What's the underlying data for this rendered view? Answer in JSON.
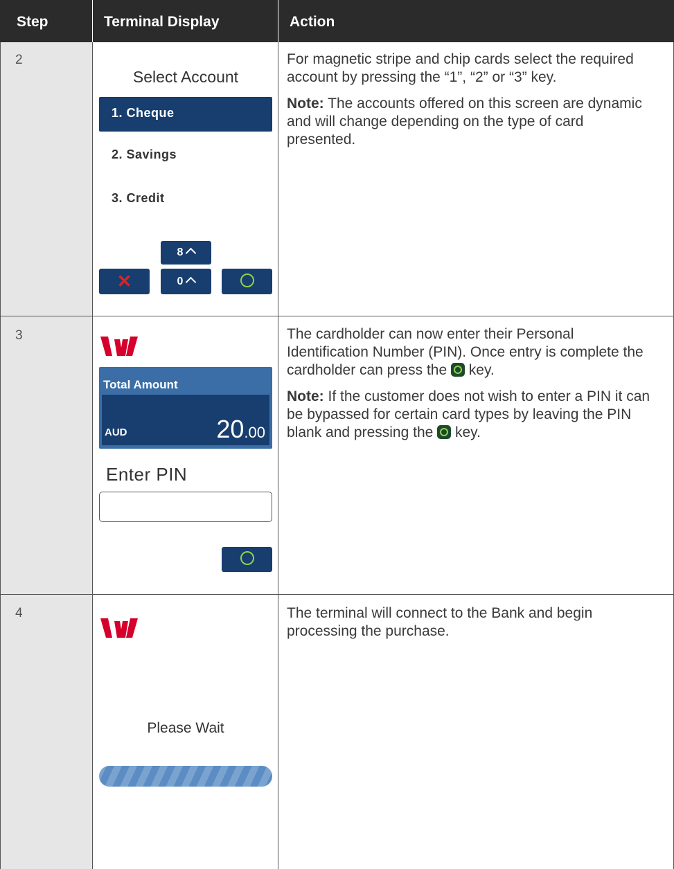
{
  "header": {
    "step": "Step",
    "display": "Terminal Display",
    "action": "Action"
  },
  "rows": [
    {
      "step": "2",
      "screen": {
        "title": "Select Account",
        "options": [
          "1. Cheque",
          "2. Savings",
          "3. Credit"
        ],
        "keys": {
          "up": "8",
          "down": "0"
        }
      },
      "action_p1": "For magnetic stripe and chip cards select the required account by pressing the “1”, “2” or “3” key.",
      "note_label": "Note:",
      "note_text": " The accounts offered on this screen are dynamic and will change depending on the type of card presented."
    },
    {
      "step": "3",
      "screen": {
        "amount_label": "Total Amount",
        "currency": "AUD",
        "amount_whole": "20",
        "amount_cents": ".00",
        "prompt": "Enter PIN"
      },
      "action_p1a": "The cardholder can now enter their Personal Identification Number (PIN). Once entry is complete the cardholder can press the ",
      "action_p1b": " key.",
      "note_label": "Note:",
      "note_text_a": " If the customer does not wish to enter a PIN it can be bypassed for certain card types by leaving the PIN blank and pressing the ",
      "note_text_b": " key."
    },
    {
      "step": "4",
      "screen": {
        "message": "Please Wait"
      },
      "action_p1": "The terminal will connect to the Bank and begin processing the purchase."
    }
  ],
  "colors": {
    "navy": "#173e6e",
    "brand_red": "#d5002b",
    "ok_green": "#8fd14f",
    "cancel_red": "#e0231c",
    "header": "#2b2b2b"
  }
}
